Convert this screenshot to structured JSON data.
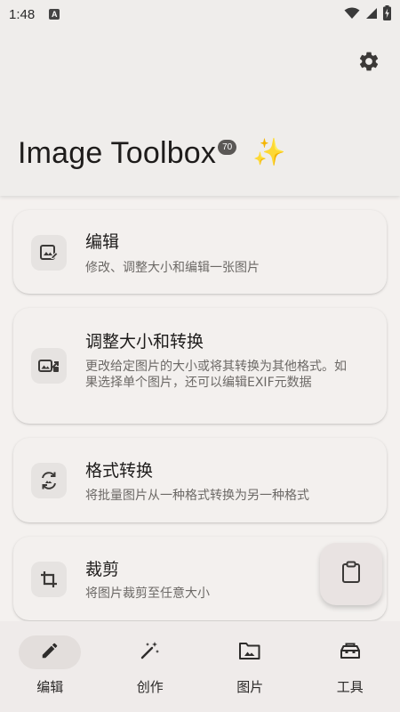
{
  "status_bar": {
    "time": "1:48",
    "notification_icon_letter": "A"
  },
  "header": {
    "app_title": "Image Toolbox",
    "version_badge": "70",
    "sparkles_emoji": "✨",
    "settings_icon": "gear-icon"
  },
  "tools": [
    {
      "title": "编辑",
      "description": "修改、调整大小和编辑一张图片",
      "icon": "edit-image-icon"
    },
    {
      "title": "调整大小和转换",
      "description": "更改给定图片的大小或将其转换为其他格式。如果选择单个图片，还可以编辑EXIF元数据",
      "icon": "resize-images-icon"
    },
    {
      "title": "格式转换",
      "description": "将批量图片从一种格式转换为另一种格式",
      "icon": "convert-cycle-icon"
    },
    {
      "title": "裁剪",
      "description": "将图片裁剪至任意大小",
      "icon": "crop-icon"
    }
  ],
  "fab": {
    "icon": "clipboard-icon"
  },
  "bottom_nav": {
    "items": [
      {
        "label": "编辑",
        "icon": "pencil-icon",
        "active": true
      },
      {
        "label": "创作",
        "icon": "magic-wand-icon",
        "active": false
      },
      {
        "label": "图片",
        "icon": "image-folder-icon",
        "active": false
      },
      {
        "label": "工具",
        "icon": "toolbox-icon",
        "active": false
      }
    ]
  },
  "colors": {
    "background": "#f4f1ef",
    "header": "#efedeb",
    "card": "#f3f0ee",
    "icon_container": "#e6e3e1",
    "badge": "#5b5856",
    "nav_active_pill": "#e3dedc",
    "title_text": "#1e1c1b",
    "description_text": "#6c6966"
  }
}
